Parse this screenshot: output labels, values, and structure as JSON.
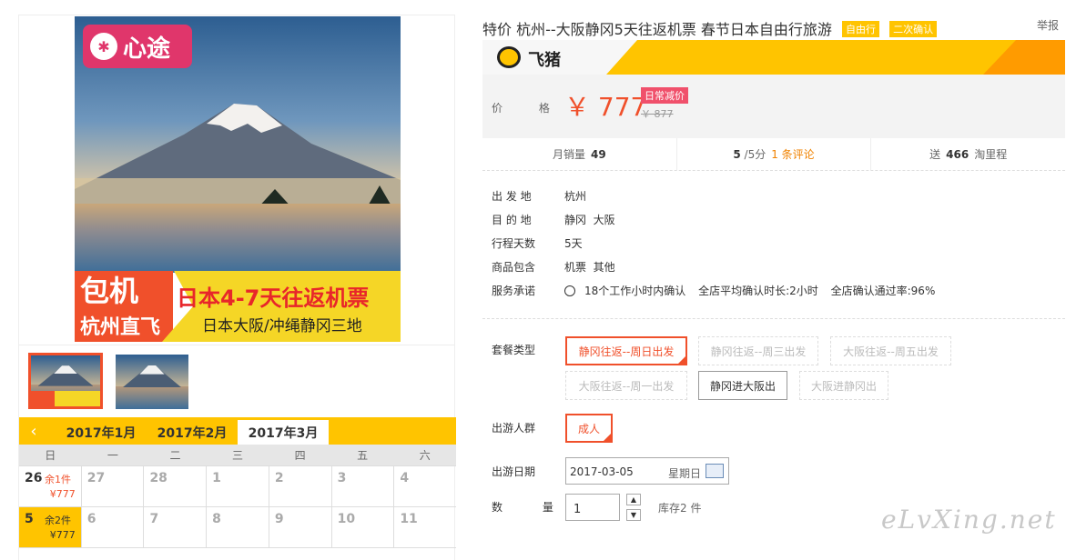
{
  "product": {
    "title": "特价 杭州--大阪静冈5天往返机票 春节日本自由行旅游",
    "tags": [
      "自由行",
      "二次确认"
    ],
    "report": "举报"
  },
  "gallery": {
    "logo_text": "心途",
    "banner_left_line1": "包机",
    "banner_left_line2": "杭州直飞",
    "banner_right_line1": "日本4-7天往返机票",
    "banner_right_line2": "日本大阪/冲绳静冈三地"
  },
  "brand": {
    "name": "飞猪"
  },
  "price": {
    "label": "价 格",
    "current": "￥ 777",
    "badge": "日常减价",
    "original": "￥ 877"
  },
  "stats": {
    "sales_label": "月销量",
    "sales_value": "49",
    "rating_value": "5",
    "rating_suffix": "/5分",
    "reviews": "1 条评论",
    "points_prefix": "送",
    "points_value": "466",
    "points_suffix": "淘里程"
  },
  "info": [
    {
      "key": "出 发 地",
      "value": "杭州"
    },
    {
      "key": "目 的 地",
      "value": "静冈  大阪"
    },
    {
      "key": "行程天数",
      "value": "5天"
    },
    {
      "key": "商品包含",
      "value": "机票  其他"
    },
    {
      "key": "服务承诺",
      "value": "18个工作小时内确认",
      "extra1": "全店平均确认时长:2小时",
      "extra2": "全店确认通过率:96%"
    }
  ],
  "package": {
    "label": "套餐类型",
    "options": [
      "静冈往返--周日出发",
      "静冈往返--周三出发",
      "大阪往返--周五出发",
      "大阪往返--周一出发",
      "静冈进大阪出",
      "大阪进静冈出"
    ]
  },
  "travelers": {
    "label": "出游人群",
    "option": "成人"
  },
  "date": {
    "label": "出游日期",
    "value": "2017-03-05",
    "weekday": "星期日"
  },
  "quantity": {
    "label": "数 量",
    "value": "1",
    "up": "▲",
    "down": "▼",
    "stock": "库存2 件"
  },
  "calendar": {
    "prev": "‹",
    "tabs": [
      "2017年1月",
      "2017年2月",
      "2017年3月"
    ],
    "weekdays": [
      "日",
      "一",
      "二",
      "三",
      "四",
      "五",
      "六"
    ],
    "row1": [
      {
        "d": "26",
        "rem": "余1件",
        "price": "¥777"
      },
      {
        "d": "27"
      },
      {
        "d": "28"
      },
      {
        "d": "1"
      },
      {
        "d": "2"
      },
      {
        "d": "3"
      },
      {
        "d": "4"
      }
    ],
    "row2": [
      {
        "d": "5",
        "rem": "余2件",
        "price": "¥777"
      },
      {
        "d": "6"
      },
      {
        "d": "7"
      },
      {
        "d": "8"
      },
      {
        "d": "9"
      },
      {
        "d": "10"
      },
      {
        "d": "11"
      }
    ]
  },
  "watermark": "eLvXing.net",
  "colors": {
    "accent": "#f0502b",
    "brand_yellow": "#ffc400"
  }
}
